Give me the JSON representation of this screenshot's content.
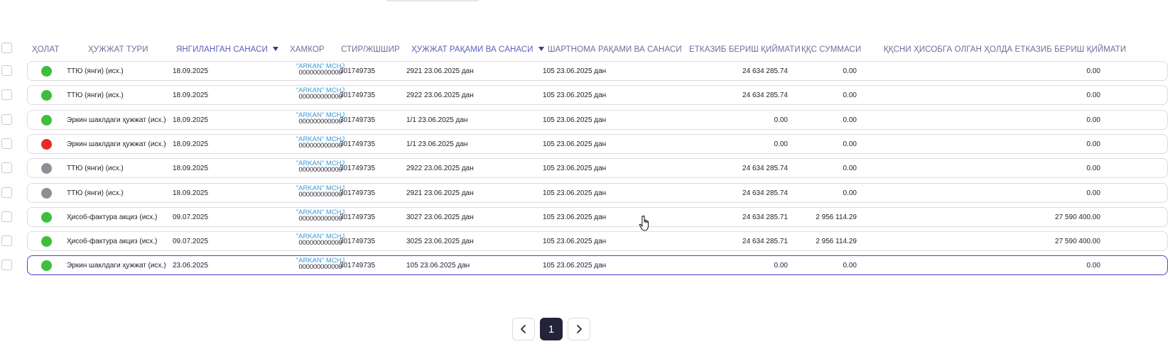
{
  "header": {
    "status": "ҲОЛАТ",
    "doc_type": "ҲУЖЖАТ ТУРИ",
    "updated_date": "ЯНГИЛАНГАН САНАСИ",
    "partner": "ХАМКОР",
    "tin": "СТИР/ЖШШИР",
    "doc_number_date": "ҲУЖЖАТ РАҚАМИ ВА САНАСИ",
    "contract_number_date": "ШАРТНОМА РАҚАМИ ВА САНАСИ",
    "delivery_cost": "ЕТКАЗИБ БЕРИШ ҚИЙМАТИ",
    "vat_amount": "ҚҚС СУММАСИ",
    "delivery_cost_with_vat": "ҚҚСНИ ҲИСОБГА ОЛГАН ҲОЛДА ЕТКАЗИБ БЕРИШ ҚИЙМАТИ"
  },
  "colors": {
    "green": "#3fbe3c",
    "red": "#e82a2a",
    "gray": "#8e8e96",
    "accent": "#4d43c8",
    "partner_link": "#3c9ad6"
  },
  "rows": [
    {
      "status": "green",
      "doc_type": "ТТЮ (янги) (исх.)",
      "updated": "18.09.2025",
      "partner_name": "\"ARKAN\" MCHJ",
      "partner_code": "000000000000",
      "tin": "301749735",
      "doc_no": "2921 23.06.2025 дан",
      "contract": "105 23.06.2025 дан",
      "delivery": "24 634 285.74",
      "vat": "0.00",
      "total": "0.00"
    },
    {
      "status": "green",
      "doc_type": "ТТЮ (янги) (исх.)",
      "updated": "18.09.2025",
      "partner_name": "\"ARKAN\" MCHJ",
      "partner_code": "000000000000",
      "tin": "301749735",
      "doc_no": "2922 23.06.2025 дан",
      "contract": "105 23.06.2025 дан",
      "delivery": "24 634 285.74",
      "vat": "0.00",
      "total": "0.00"
    },
    {
      "status": "green",
      "doc_type": "Эркин шаклдаги ҳужжат (исх.)",
      "updated": "18.09.2025",
      "partner_name": "\"ARKAN\" MCHJ",
      "partner_code": "000000000000",
      "tin": "301749735",
      "doc_no": "1/1 23.06.2025 дан",
      "contract": "105 23.06.2025 дан",
      "delivery": "0.00",
      "vat": "0.00",
      "total": "0.00"
    },
    {
      "status": "red",
      "doc_type": "Эркин шаклдаги ҳужжат (исх.)",
      "updated": "18.09.2025",
      "partner_name": "\"ARKAN\" MCHJ",
      "partner_code": "000000000000",
      "tin": "301749735",
      "doc_no": "1/1 23.06.2025 дан",
      "contract": "105 23.06.2025 дан",
      "delivery": "0.00",
      "vat": "0.00",
      "total": "0.00"
    },
    {
      "status": "gray",
      "doc_type": "ТТЮ (янги) (исх.)",
      "updated": "18.09.2025",
      "partner_name": "\"ARKAN\" MCHJ",
      "partner_code": "000000000000",
      "tin": "301749735",
      "doc_no": "2922 23.06.2025 дан",
      "contract": "105 23.06.2025 дан",
      "delivery": "24 634 285.74",
      "vat": "0.00",
      "total": "0.00"
    },
    {
      "status": "gray",
      "doc_type": "ТТЮ (янги) (исх.)",
      "updated": "18.09.2025",
      "partner_name": "\"ARKAN\" MCHJ",
      "partner_code": "000000000000",
      "tin": "301749735",
      "doc_no": "2921 23.06.2025 дан",
      "contract": "105 23.06.2025 дан",
      "delivery": "24 634 285.74",
      "vat": "0.00",
      "total": "0.00"
    },
    {
      "status": "green",
      "doc_type": "Ҳисоб-фактура акциз (исх.)",
      "updated": "09.07.2025",
      "partner_name": "\"ARKAN\" MCHJ",
      "partner_code": "000000000000",
      "tin": "301749735",
      "doc_no": "3027 23.06.2025 дан",
      "contract": "105 23.06.2025 дан",
      "delivery": "24 634 285.71",
      "vat": "2 956 114.29",
      "total": "27 590 400.00"
    },
    {
      "status": "green",
      "doc_type": "Ҳисоб-фактура акциз (исх.)",
      "updated": "09.07.2025",
      "partner_name": "\"ARKAN\" MCHJ",
      "partner_code": "000000000000",
      "tin": "301749735",
      "doc_no": "3025 23.06.2025 дан",
      "contract": "105 23.06.2025 дан",
      "delivery": "24 634 285.71",
      "vat": "2 956 114.29",
      "total": "27 590 400.00"
    },
    {
      "status": "green",
      "doc_type": "Эркин шаклдаги ҳужжат (исх.)",
      "updated": "23.06.2025",
      "partner_name": "\"ARKAN\" MCHJ",
      "partner_code": "000000000000",
      "tin": "301749735",
      "doc_no": "105 23.06.2025 дан",
      "contract": "105 23.06.2025 дан",
      "delivery": "0.00",
      "vat": "0.00",
      "total": "0.00",
      "selected": true
    }
  ],
  "pagination": {
    "prev_icon": "chevron-left-icon",
    "next_icon": "chevron-right-icon",
    "current_page": "1"
  }
}
